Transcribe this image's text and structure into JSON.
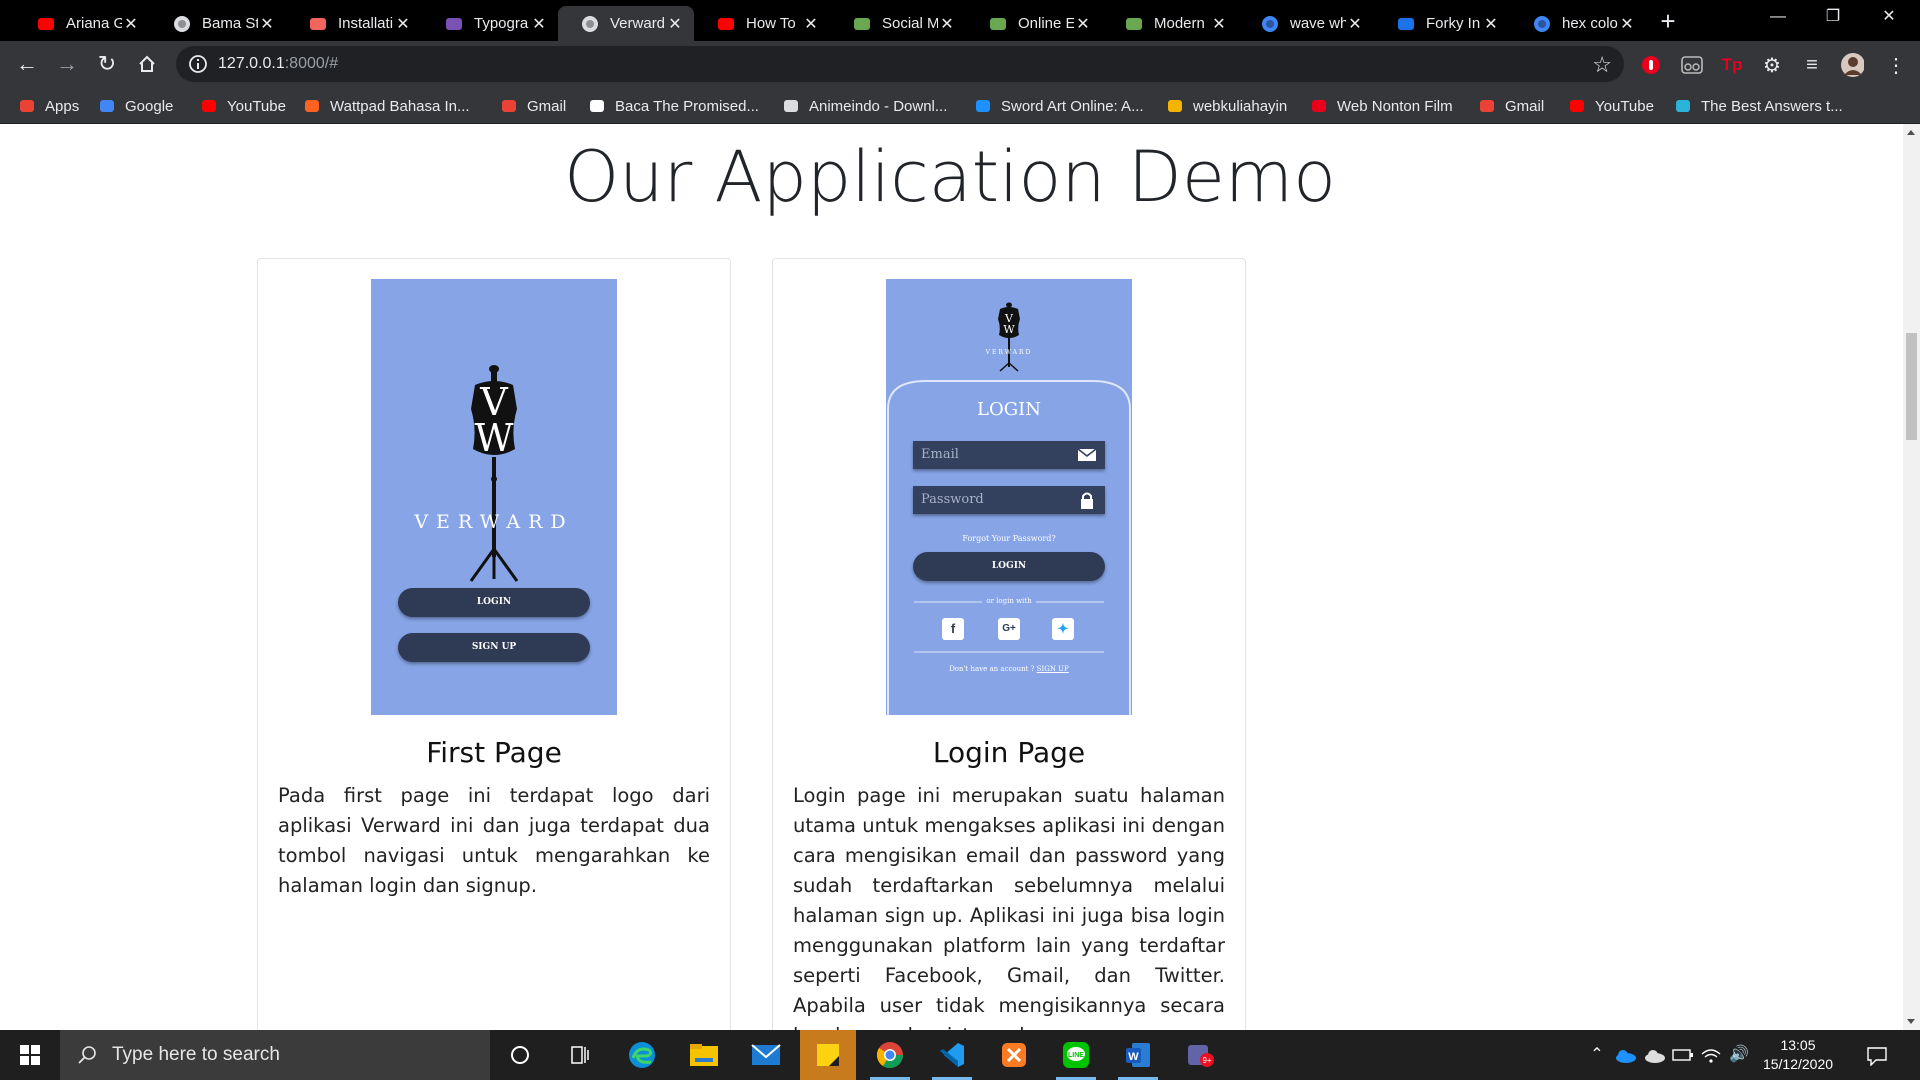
{
  "browser": {
    "tabs": [
      {
        "title": "Ariana G",
        "icon": "youtube-icon",
        "color": "#ff0000"
      },
      {
        "title": "Bama St",
        "icon": "globe-icon",
        "color": "#dadce0"
      },
      {
        "title": "Installati",
        "icon": "laravel-icon",
        "color": "#f4645f"
      },
      {
        "title": "Typogra",
        "icon": "bootstrap-icon",
        "color": "#7952b3"
      },
      {
        "title": "Verward",
        "icon": "globe-icon",
        "color": "#dadce0"
      },
      {
        "title": "How To",
        "icon": "youtube-icon",
        "color": "#ff0000"
      },
      {
        "title": "Social M",
        "icon": "page-icon",
        "color": "#6aa84f"
      },
      {
        "title": "Online E",
        "icon": "page-icon",
        "color": "#6aa84f"
      },
      {
        "title": "Modern",
        "icon": "page-icon",
        "color": "#6aa84f"
      },
      {
        "title": "wave wh",
        "icon": "google-icon",
        "color": "#4285f4"
      },
      {
        "title": "Forky In",
        "icon": "f-icon",
        "color": "#1a73e8"
      },
      {
        "title": "hex colo",
        "icon": "google-icon",
        "color": "#4285f4"
      }
    ],
    "active_tab": 4,
    "close_glyph": "✕",
    "url_host": "127.0.0.1",
    "url_rest": ":8000/#",
    "bookmarks": [
      {
        "label": "Apps",
        "icon": "apps-grid-icon"
      },
      {
        "label": "Google",
        "icon": "google-icon"
      },
      {
        "label": "YouTube",
        "icon": "youtube-icon"
      },
      {
        "label": "Wattpad Bahasa In...",
        "icon": "wattpad-icon"
      },
      {
        "label": "Gmail",
        "icon": "gmail-icon"
      },
      {
        "label": "Baca The Promised...",
        "icon": "book-icon"
      },
      {
        "label": "Animeindo - Downl...",
        "icon": "globe-icon"
      },
      {
        "label": "Sword Art Online: A...",
        "icon": "edge-icon"
      },
      {
        "label": "webkuliahayin",
        "icon": "webkuliah-icon"
      },
      {
        "label": "Web Nonton Film",
        "icon": "film-icon"
      },
      {
        "label": "Gmail",
        "icon": "gmail-icon"
      },
      {
        "label": "YouTube",
        "icon": "youtube-icon"
      },
      {
        "label": "The Best Answers t...",
        "icon": "m-icon"
      }
    ]
  },
  "page": {
    "section_title": "Our Application Demo",
    "cards": [
      {
        "title": "First Page",
        "description": "Pada first page ini terdapat logo dari aplikasi Verward ini dan juga terdapat dua tombol navigasi untuk mengarahkan ke halaman login dan signup.",
        "mockup": {
          "brand": "VERWARD",
          "login_button": "LOGIN",
          "signup_button": "SIGN UP"
        }
      },
      {
        "title": "Login Page",
        "description": "Login page ini merupakan suatu halaman utama untuk mengakses aplikasi ini dengan cara mengisikan email dan password yang sudah terdaftarkan sebelumnya melalui halaman sign up. Aplikasi ini juga bisa login menggunakan platform lain yang terdaftar seperti Facebook, Gmail, dan Twitter. Apabila user tidak mengisikannya secara lengkap maka sistem akan",
        "mockup": {
          "brand": "VERWARD",
          "heading": "LOGIN",
          "email_placeholder": "Email",
          "password_placeholder": "Password",
          "forgot": "Forgot Your Password?",
          "login_button": "LOGIN",
          "or_login_with": "or login with",
          "no_account": "Don't have an account ?",
          "signup_link": "SIGN UP"
        }
      }
    ],
    "mockup_bg": "#86a4e6",
    "mockup_button_color": "#2f3a55"
  },
  "taskbar": {
    "search_placeholder": "Type here to search",
    "time": "13:05",
    "date": "15/12/2020",
    "apps": [
      "cortana-icon",
      "task-view-icon",
      "edge-icon",
      "file-explorer-icon",
      "mail-icon",
      "sticky-notes-icon",
      "chrome-icon",
      "vscode-icon",
      "xampp-icon",
      "line-icon",
      "word-icon",
      "teams-icon"
    ]
  }
}
